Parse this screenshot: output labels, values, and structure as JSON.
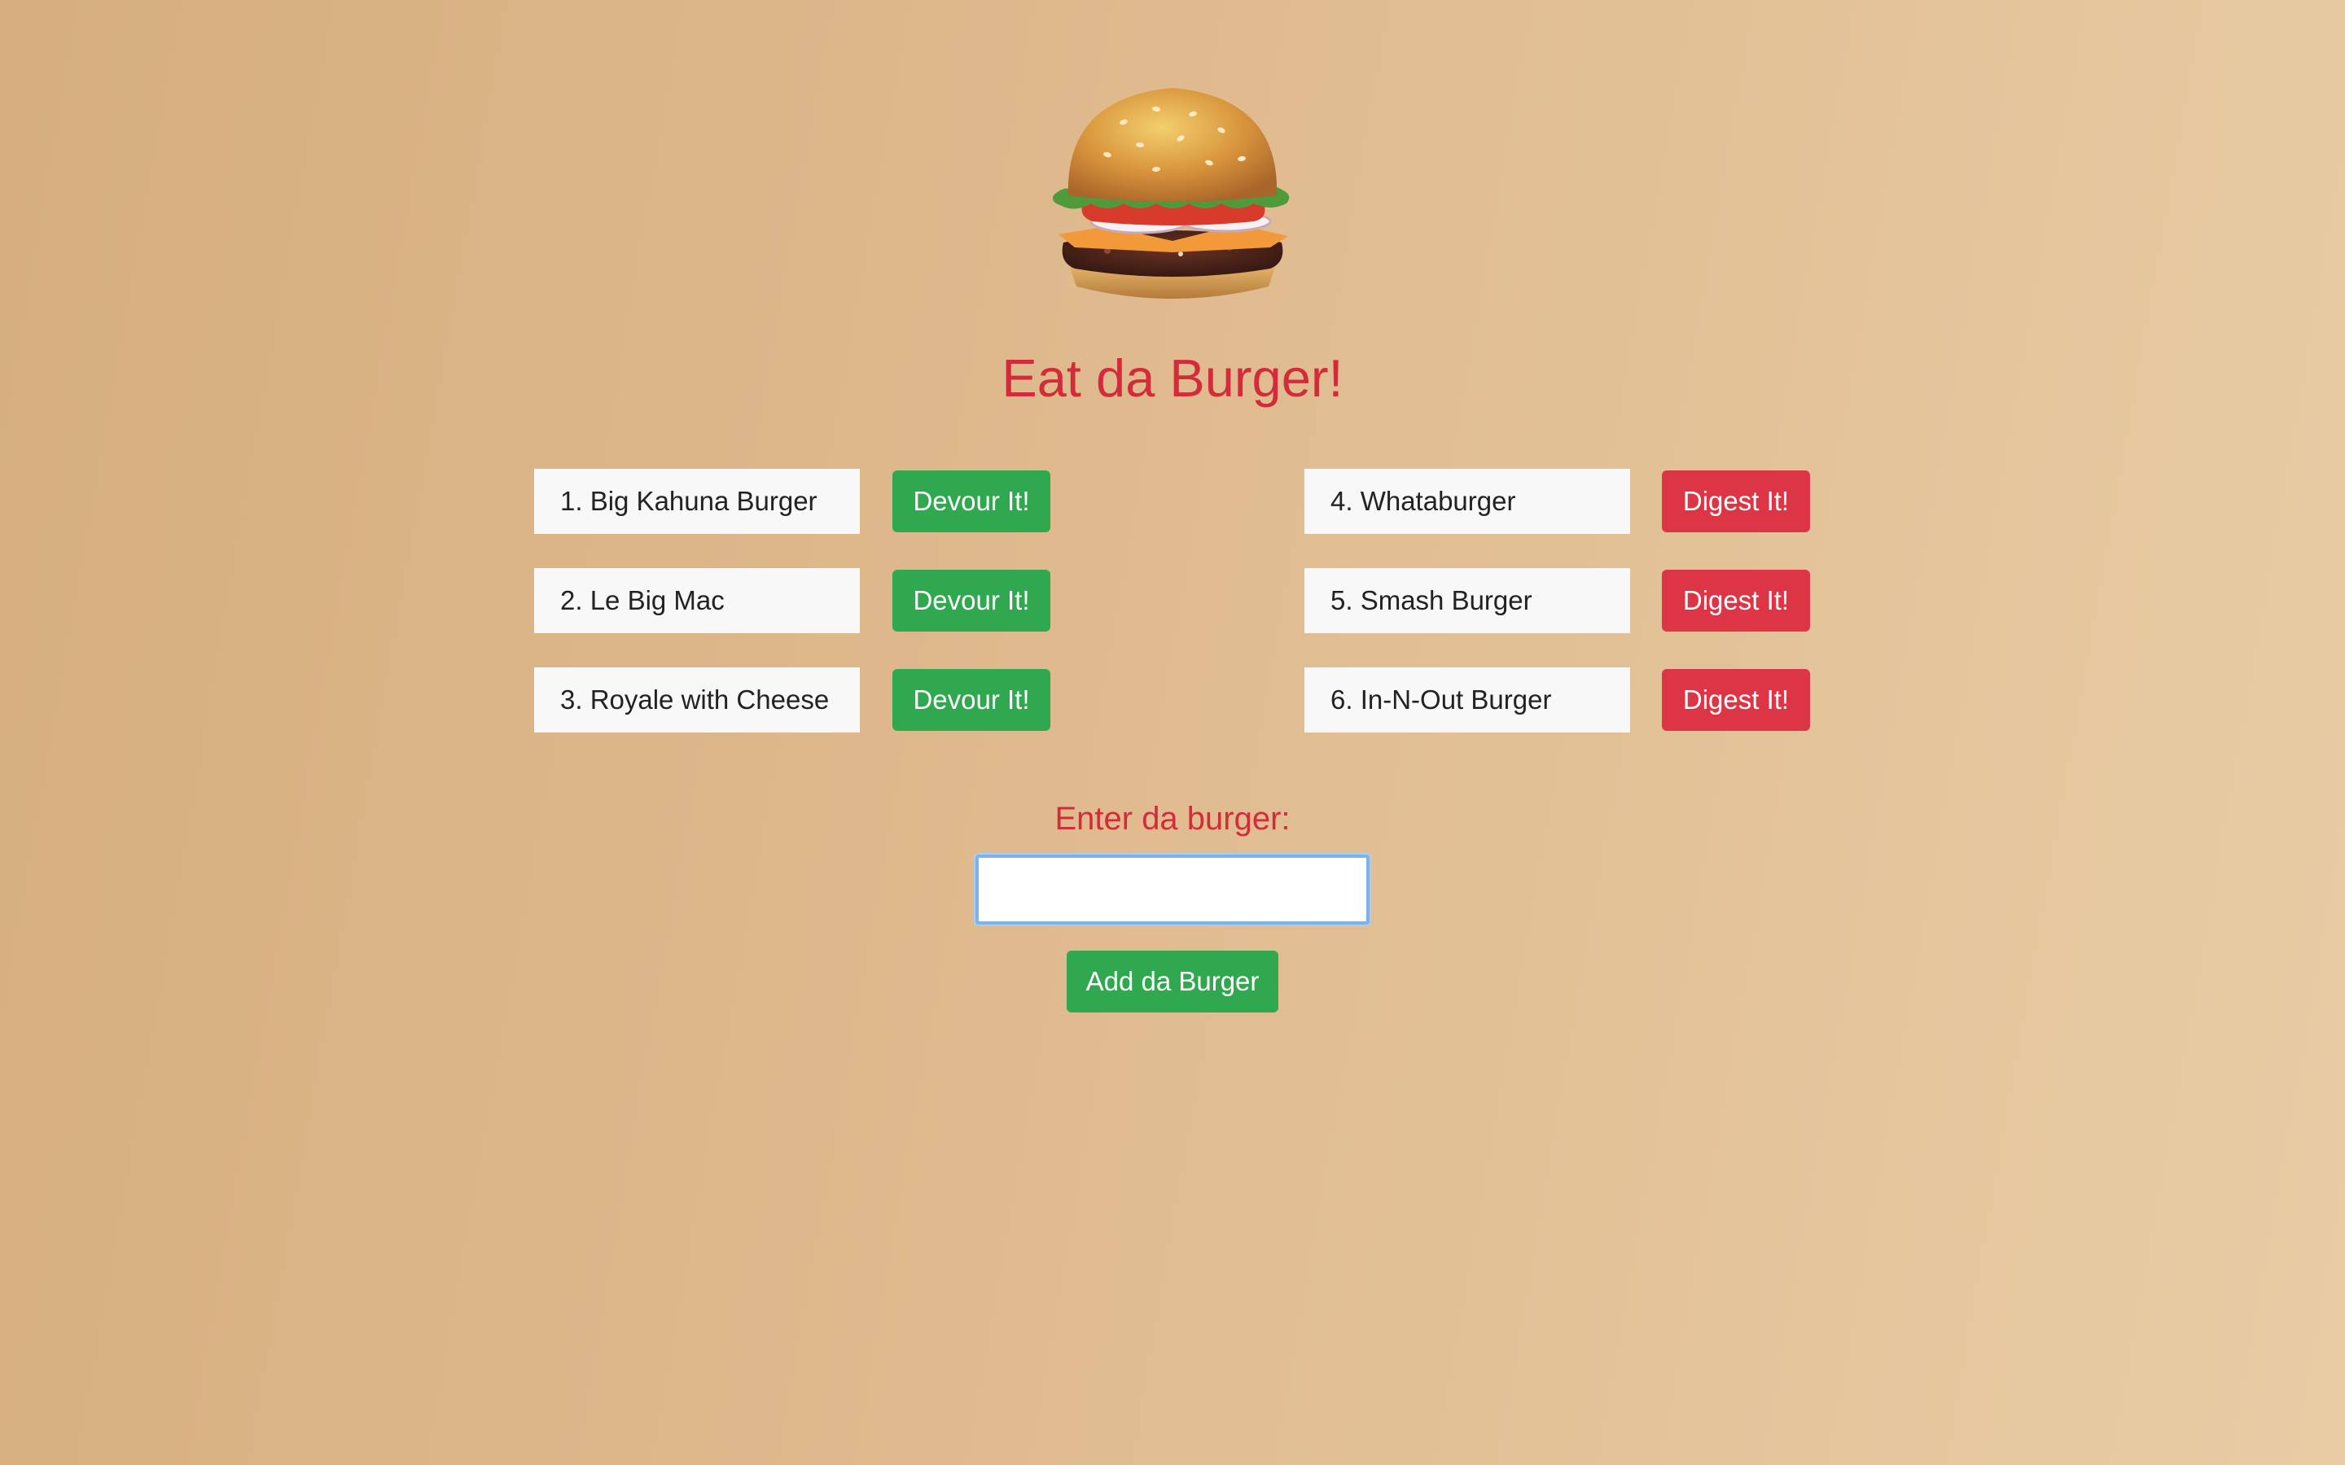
{
  "header": {
    "logo_icon": "burger-logo-icon",
    "title": "Eat da Burger!",
    "title_color": "#d42b3a"
  },
  "undevoured": [
    {
      "label": "1. Big Kahuna Burger",
      "button": "Devour It!"
    },
    {
      "label": "2. Le Big Mac",
      "button": "Devour It!"
    },
    {
      "label": "3. Royale with Cheese",
      "button": "Devour It!"
    }
  ],
  "devoured": [
    {
      "label": "4. Whataburger",
      "button": "Digest It!"
    },
    {
      "label": "5. Smash Burger",
      "button": "Digest It!"
    },
    {
      "label": "6. In-N-Out Burger",
      "button": "Digest It!"
    }
  ],
  "form": {
    "label": "Enter da burger:",
    "input_value": "",
    "submit_label": "Add da Burger"
  },
  "colors": {
    "green": "#2fa84f",
    "red": "#dc3545",
    "accent_text": "#d42b3a"
  }
}
